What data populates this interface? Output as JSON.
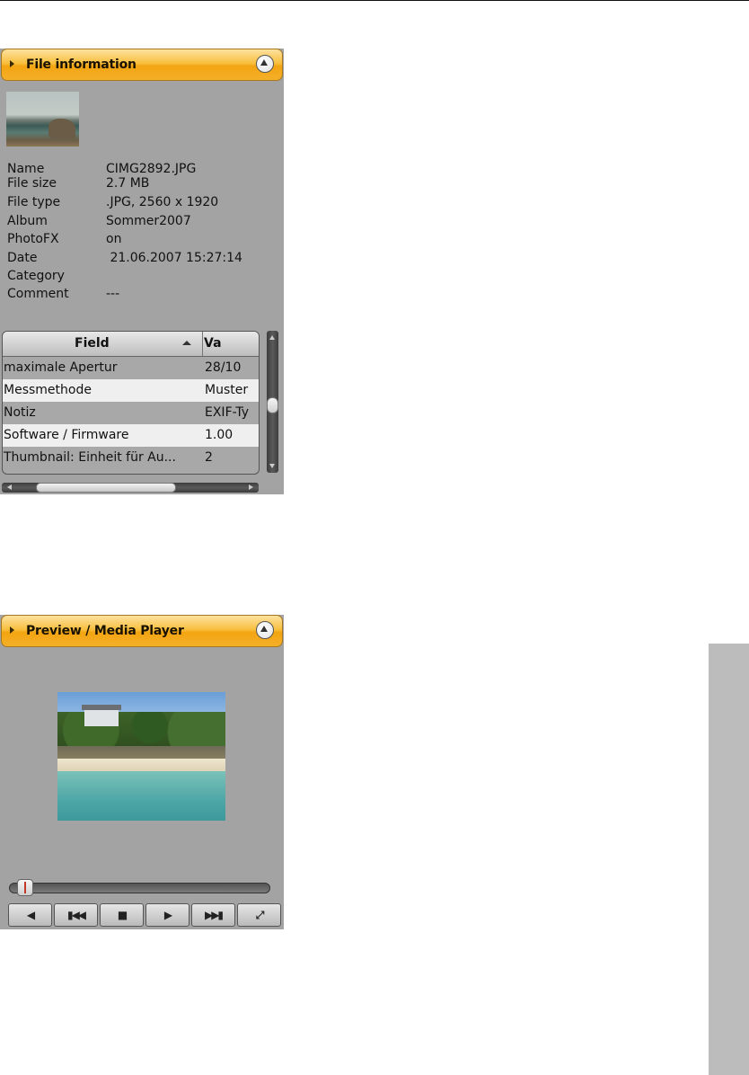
{
  "file_info_panel": {
    "title": "File information",
    "fields": [
      {
        "label": "Name",
        "value": "CIMG2892.JPG"
      },
      {
        "label": "File size",
        "value": "2.7 MB"
      },
      {
        "label": "File type",
        "value": ".JPG, 2560 x 1920"
      },
      {
        "label": "Album",
        "value": "Sommer2007"
      },
      {
        "label": "PhotoFX",
        "value": "on"
      },
      {
        "label": "Date",
        "value": " 21.06.2007 15:27:14"
      },
      {
        "label": "Category",
        "value": ""
      },
      {
        "label": "Comment",
        "value": "---"
      }
    ],
    "table": {
      "columns": [
        "Field",
        "Va"
      ],
      "rows": [
        {
          "field": "maximale Apertur",
          "value": "28/10"
        },
        {
          "field": "Messmethode",
          "value": "Muster"
        },
        {
          "field": "Notiz",
          "value": "EXIF-Ty"
        },
        {
          "field": "Software / Firmware",
          "value": "1.00"
        },
        {
          "field": "Thumbnail: Einheit für Au...",
          "value": "2"
        }
      ]
    }
  },
  "preview_panel": {
    "title": "Preview / Media Player",
    "playback_position": 0.02,
    "controls": {
      "mute": "◀",
      "previous": "▮◀◀",
      "stop": "■",
      "play": "▶",
      "next": "▶▶▮",
      "fullscreen": "⤢"
    }
  }
}
